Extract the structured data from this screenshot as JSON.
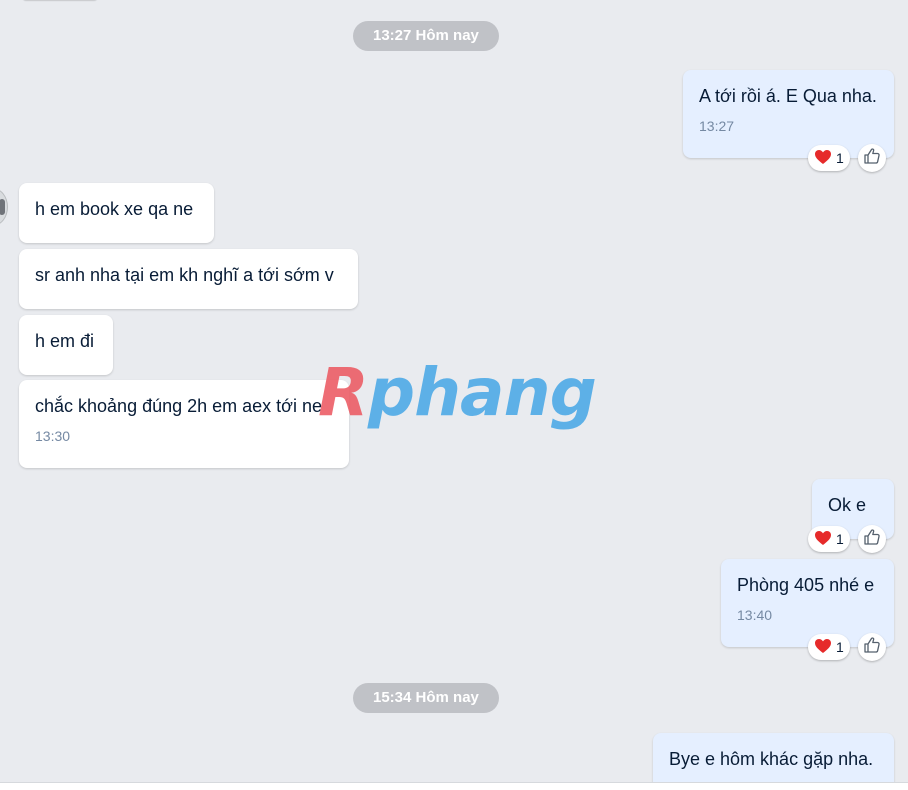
{
  "timestamps": {
    "first": "13:27 Hôm nay",
    "second": "15:34 Hôm nay"
  },
  "messages": {
    "m1": {
      "text": "A tới rồi á. E Qua nha.",
      "time": "13:27",
      "reaction_count": "1"
    },
    "m2": {
      "text": "h em book xe qa ne"
    },
    "m3": {
      "text": "sr anh nha tại em kh nghĩ a tới sớm v"
    },
    "m4": {
      "text": "h em đi"
    },
    "m5": {
      "text": "chắc khoảng đúng 2h em aex tới ne",
      "time": "13:30"
    },
    "m6": {
      "text": "Ok e",
      "reaction_count": "1"
    },
    "m7": {
      "text": "Phòng 405 nhé e",
      "time": "13:40",
      "reaction_count": "1"
    },
    "m8": {
      "text": "Bye e hôm khác gặp nha."
    }
  },
  "watermark": {
    "first_letter": "R",
    "rest": "phang"
  },
  "colors": {
    "background": "#e9ebef",
    "incoming_bubble": "#ffffff",
    "outgoing_bubble": "#e5efff",
    "time_pill": "#c0c2c7",
    "heart": "#e62a2a",
    "watermark_red": "#ec5a62",
    "watermark_blue": "#4aa8e6"
  },
  "icons": {
    "reaction": "heart-icon",
    "like": "thumbs-up-icon"
  }
}
